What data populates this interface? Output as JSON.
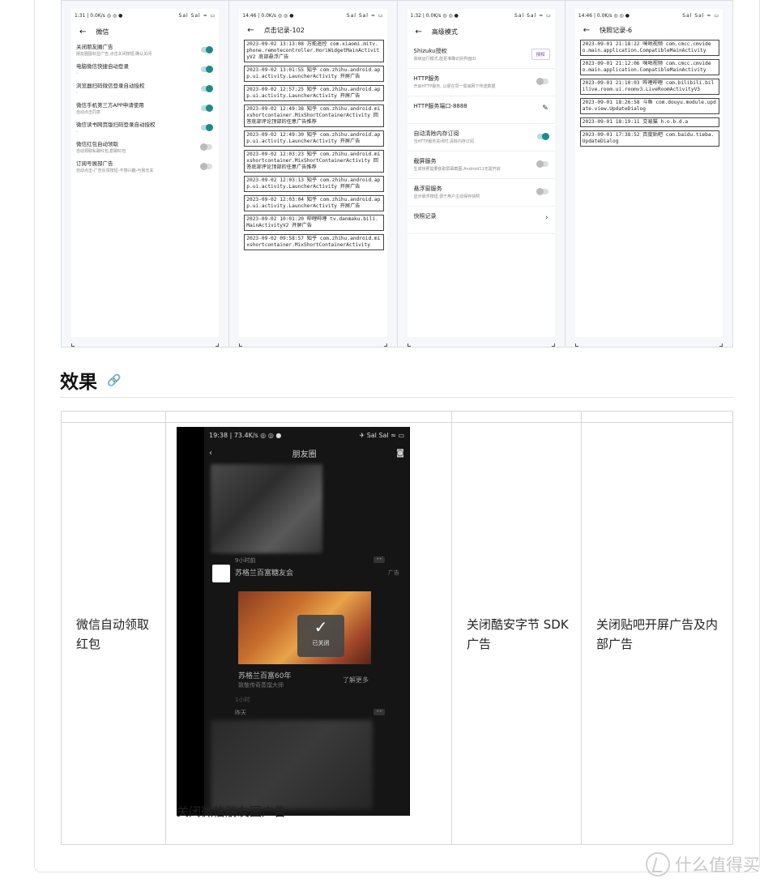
{
  "panel1": {
    "status_left": "1:31 | 0.0K/s ◎ ◎ ●",
    "status_right": "Sal Sal ≈ ▭",
    "title": "微信",
    "items": [
      {
        "title": "关闭朋友圈广告",
        "sub": "朋友圈图标显广告,点击关闭按钮,确认关闭",
        "on": true
      },
      {
        "title": "电脑微信快捷自动登录",
        "sub": "-",
        "on": true
      },
      {
        "title": "浏览器扫码微信登录自动授权",
        "sub": "-",
        "on": true
      },
      {
        "title": "微信手机第三方APP申请使用",
        "sub": "自动点击同意",
        "on": true
      },
      {
        "title": "微信读书网页版扫码登录自动授权",
        "sub": "-",
        "on": true
      },
      {
        "title": "微信红包自动领取",
        "sub": "自动领取私聊红包,群聊红包",
        "on": false
      },
      {
        "title": "订阅号展部广告",
        "sub": "自动点击-广告反馈按钮-不感兴趣-与我无关",
        "on": false
      }
    ]
  },
  "panel2": {
    "status_left": "14:46 | 0.0K/s ◎ ◎ ●",
    "status_right": "Sal Sal ≈ ▭",
    "title": "点击记录-102",
    "logs": [
      "2023-09-02 13:13:08 万能遥控 com.xiaomi.mitv.phone.remotecontroller.HoriWidgetMainActivityV2 底部悬浮广告",
      "2023-09-02 13:01:55 知乎 com.zhihu.android.app.ui.activity.LauncherActivity 开屏广告",
      "2023-09-02 12:57:25 知乎 com.zhihu.android.app.ui.activity.LauncherActivity 开屏广告",
      "2023-09-02 12:49:38 知乎 com.zhihu.android.mixshortcontainer.MixShortContainerActivity 回答底部评论顶部的任意广告推荐",
      "2023-09-02 12:49:30 知乎 com.zhihu.android.app.ui.activity.LauncherActivity 开屏广告",
      "2023-09-02 12:03:23 知乎 com.zhihu.android.mixshortcontainer.MixShortContainerActivity 回答底部评论顶部的任意广告推荐",
      "2023-09-02 12:03:13 知乎 com.zhihu.android.app.ui.activity.LauncherActivity 开屏广告",
      "2023-09-02 12:03:04 知乎 com.zhihu.android.app.ui.activity.LauncherActivity 开屏广告",
      "2023-09-02 10:01:20 哔哩哔哩 tv.danmaku.bili.MainActivityV2 开屏广告",
      "2023-09-02 09:58:57 知乎 com.zhihu.android.mixshortcontainer.MixShortContainerActivity"
    ]
  },
  "panel3": {
    "status_left": "1:32 | 0.0K/s ◎ ◎ ●",
    "status_right": "Sal Sal ≈ ▭",
    "title": "高级模式",
    "items": [
      {
        "title": "Shizuku授权",
        "sub": "高级运行模式,能更准确识别界面ID",
        "control": "授权"
      },
      {
        "title": "HTTP服务",
        "sub": "开启HTTP服务, 以便在同一局域网下传送数据",
        "control": "toggle-off"
      },
      {
        "title": "HTTP服务端口-8888",
        "sub": "",
        "control": "pencil"
      },
      {
        "title": "自动清除内存订阅",
        "sub": "当HTTP服务关闭时,清除内存订阅",
        "control": "toggle-on"
      },
      {
        "title": "截屏服务",
        "sub": "生成快照需要获取屏幕截图,Android11无需开启",
        "control": "toggle-off"
      },
      {
        "title": "悬浮窗服务",
        "sub": "显示悬浮按钮,便于用户主动保存快照",
        "control": "toggle-off"
      },
      {
        "title": "快照记录",
        "sub": "",
        "control": "chevron"
      }
    ]
  },
  "panel4": {
    "status_left": "14:46 | 0.0K/s ◎ ◎ ●",
    "status_right": "Sal Sal ≈ ▭",
    "title": "快照记录-6",
    "logs": [
      "2023-09-01 21:18:22 咪咕视频 com.cmcc.cmvideo.main.application.CompatibleMainActivity",
      "2023-09-01 21:12:06 咪咕视频 com.cmcc.cmvideo.main.application.CompatibleMainActivity",
      "2023-09-01 21:10:03 哔哩哔哩 com.bilibili.bililive.room.ui.roomv3.LiveRoomActivityV3",
      "2023-09-01 18:26:58 斗鱼 com.douyu.module.update.view.UpdateDialog",
      "2023-09-01 18:19:11 交易猫 h.o.b.d.a",
      "2023-09-01 17:38:52 百度贴吧 com.baidu.tieba.UpdateDialog"
    ]
  },
  "section_heading": "效果",
  "table": {
    "cells": [
      "微信自动领取红包",
      "关闭微信朋友圈广告",
      "关闭酷安字节 SDK 广告",
      "关闭贴吧开屏广告及内部广告"
    ]
  },
  "video": {
    "status_left": "19:38 | 73.4K/s ◎ ◎ ●",
    "status_right": "✈ Sal Sal ≈ ▭",
    "title": "朋友圈",
    "time1": "9小时前",
    "ad_name": "苏格兰百富糖友会",
    "ad_tag": "广告",
    "closed_label": "已关闭",
    "ad_title": "苏格兰百富60年",
    "ad_sub": "致敬传奇蒸馏大师",
    "ad_more": "了解更多",
    "ad_time": "1小时",
    "time2": "昨天"
  },
  "watermark": "什么值得买"
}
